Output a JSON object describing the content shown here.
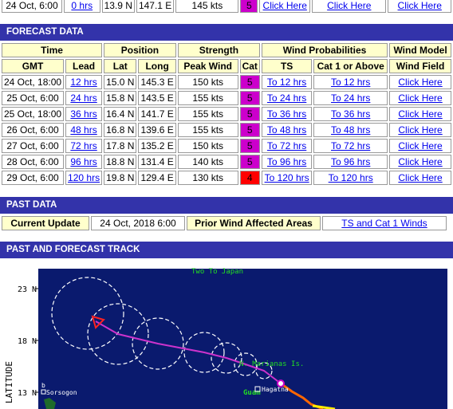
{
  "top_row": {
    "gmt": "24 Oct, 6:00",
    "lead": "0 hrs",
    "lat": "13.9 N",
    "long": "147.1 E",
    "peak_wind": "145 kts",
    "cat": "5",
    "ts_link": "Click Here",
    "cat1_link": "Click Here",
    "wind_field_link": "Click Here"
  },
  "forecast": {
    "section_title": "FORECAST DATA",
    "group_headers": {
      "time": "Time",
      "position": "Position",
      "strength": "Strength",
      "wind_prob": "Wind Probabilities",
      "wind_model": "Wind Model"
    },
    "columns": {
      "gmt": "GMT",
      "lead": "Lead",
      "lat": "Lat",
      "long": "Long",
      "peak_wind": "Peak Wind",
      "cat": "Cat",
      "ts": "TS",
      "cat1": "Cat 1 or Above",
      "wind_field": "Wind Field"
    },
    "rows": [
      {
        "gmt": "24 Oct, 18:00",
        "lead": "12 hrs",
        "lat": "15.0 N",
        "long": "145.3 E",
        "peak": "150 kts",
        "cat": "5",
        "ts": "To 12 hrs",
        "cat1": "To 12 hrs",
        "field": "Click Here"
      },
      {
        "gmt": "25 Oct, 6:00",
        "lead": "24 hrs",
        "lat": "15.8 N",
        "long": "143.5 E",
        "peak": "155 kts",
        "cat": "5",
        "ts": "To 24 hrs",
        "cat1": "To 24 hrs",
        "field": "Click Here"
      },
      {
        "gmt": "25 Oct, 18:00",
        "lead": "36 hrs",
        "lat": "16.4 N",
        "long": "141.7 E",
        "peak": "155 kts",
        "cat": "5",
        "ts": "To 36 hrs",
        "cat1": "To 36 hrs",
        "field": "Click Here"
      },
      {
        "gmt": "26 Oct, 6:00",
        "lead": "48 hrs",
        "lat": "16.8 N",
        "long": "139.6 E",
        "peak": "155 kts",
        "cat": "5",
        "ts": "To 48 hrs",
        "cat1": "To 48 hrs",
        "field": "Click Here"
      },
      {
        "gmt": "27 Oct, 6:00",
        "lead": "72 hrs",
        "lat": "17.8 N",
        "long": "135.2 E",
        "peak": "150 kts",
        "cat": "5",
        "ts": "To 72 hrs",
        "cat1": "To 72 hrs",
        "field": "Click Here"
      },
      {
        "gmt": "28 Oct, 6:00",
        "lead": "96 hrs",
        "lat": "18.8 N",
        "long": "131.4 E",
        "peak": "140 kts",
        "cat": "5",
        "ts": "To 96 hrs",
        "cat1": "To 96 hrs",
        "field": "Click Here"
      },
      {
        "gmt": "29 Oct, 6:00",
        "lead": "120 hrs",
        "lat": "19.8 N",
        "long": "129.4 E",
        "peak": "130 kts",
        "cat": "4",
        "ts": "To 120 hrs",
        "cat1": "To 120 hrs",
        "field": "Click Here"
      }
    ]
  },
  "past": {
    "section_title": "PAST DATA",
    "current_update_label": "Current Update",
    "current_update_value": "24 Oct, 2018 6:00",
    "prior_label": "Prior Wind Affected Areas",
    "prior_link": "TS and Cat 1 Winds"
  },
  "track": {
    "section_title": "PAST AND FORECAST TRACK",
    "lat_labels": [
      "23 N",
      "18 N",
      "13 N"
    ],
    "axis_title": "LATITUDE",
    "places": {
      "marianas": "N. Marianas Is.",
      "guam": "Guam",
      "hagatna": "Hagatna",
      "sorsogon": "Sorsogon",
      "japan": "Two To Japan"
    }
  },
  "colors": {
    "header_bar": "#3333aa",
    "header_cell": "#ffffcc",
    "cat5": "#cc00cc",
    "cat4": "#ff0000",
    "map_bg": "#0a1a6e",
    "track": "#cc33cc",
    "land": "#1f6b2a"
  }
}
